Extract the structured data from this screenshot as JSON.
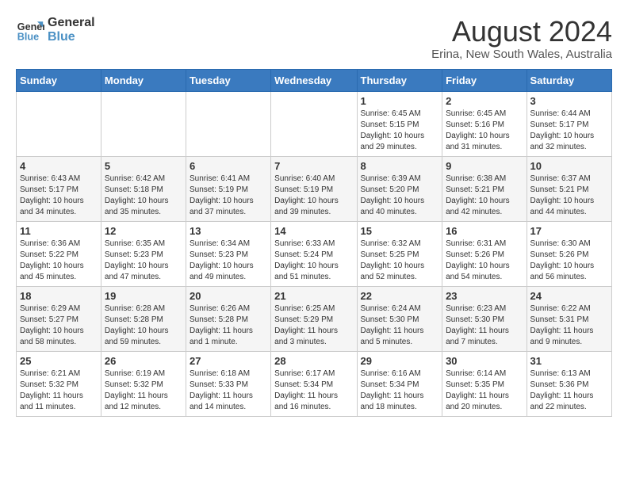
{
  "logo": {
    "line1": "General",
    "line2": "Blue"
  },
  "title": "August 2024",
  "subtitle": "Erina, New South Wales, Australia",
  "days_of_week": [
    "Sunday",
    "Monday",
    "Tuesday",
    "Wednesday",
    "Thursday",
    "Friday",
    "Saturday"
  ],
  "weeks": [
    [
      {
        "day": "",
        "info": ""
      },
      {
        "day": "",
        "info": ""
      },
      {
        "day": "",
        "info": ""
      },
      {
        "day": "",
        "info": ""
      },
      {
        "day": "1",
        "info": "Sunrise: 6:45 AM\nSunset: 5:15 PM\nDaylight: 10 hours\nand 29 minutes."
      },
      {
        "day": "2",
        "info": "Sunrise: 6:45 AM\nSunset: 5:16 PM\nDaylight: 10 hours\nand 31 minutes."
      },
      {
        "day": "3",
        "info": "Sunrise: 6:44 AM\nSunset: 5:17 PM\nDaylight: 10 hours\nand 32 minutes."
      }
    ],
    [
      {
        "day": "4",
        "info": "Sunrise: 6:43 AM\nSunset: 5:17 PM\nDaylight: 10 hours\nand 34 minutes."
      },
      {
        "day": "5",
        "info": "Sunrise: 6:42 AM\nSunset: 5:18 PM\nDaylight: 10 hours\nand 35 minutes."
      },
      {
        "day": "6",
        "info": "Sunrise: 6:41 AM\nSunset: 5:19 PM\nDaylight: 10 hours\nand 37 minutes."
      },
      {
        "day": "7",
        "info": "Sunrise: 6:40 AM\nSunset: 5:19 PM\nDaylight: 10 hours\nand 39 minutes."
      },
      {
        "day": "8",
        "info": "Sunrise: 6:39 AM\nSunset: 5:20 PM\nDaylight: 10 hours\nand 40 minutes."
      },
      {
        "day": "9",
        "info": "Sunrise: 6:38 AM\nSunset: 5:21 PM\nDaylight: 10 hours\nand 42 minutes."
      },
      {
        "day": "10",
        "info": "Sunrise: 6:37 AM\nSunset: 5:21 PM\nDaylight: 10 hours\nand 44 minutes."
      }
    ],
    [
      {
        "day": "11",
        "info": "Sunrise: 6:36 AM\nSunset: 5:22 PM\nDaylight: 10 hours\nand 45 minutes."
      },
      {
        "day": "12",
        "info": "Sunrise: 6:35 AM\nSunset: 5:23 PM\nDaylight: 10 hours\nand 47 minutes."
      },
      {
        "day": "13",
        "info": "Sunrise: 6:34 AM\nSunset: 5:23 PM\nDaylight: 10 hours\nand 49 minutes."
      },
      {
        "day": "14",
        "info": "Sunrise: 6:33 AM\nSunset: 5:24 PM\nDaylight: 10 hours\nand 51 minutes."
      },
      {
        "day": "15",
        "info": "Sunrise: 6:32 AM\nSunset: 5:25 PM\nDaylight: 10 hours\nand 52 minutes."
      },
      {
        "day": "16",
        "info": "Sunrise: 6:31 AM\nSunset: 5:26 PM\nDaylight: 10 hours\nand 54 minutes."
      },
      {
        "day": "17",
        "info": "Sunrise: 6:30 AM\nSunset: 5:26 PM\nDaylight: 10 hours\nand 56 minutes."
      }
    ],
    [
      {
        "day": "18",
        "info": "Sunrise: 6:29 AM\nSunset: 5:27 PM\nDaylight: 10 hours\nand 58 minutes."
      },
      {
        "day": "19",
        "info": "Sunrise: 6:28 AM\nSunset: 5:28 PM\nDaylight: 10 hours\nand 59 minutes."
      },
      {
        "day": "20",
        "info": "Sunrise: 6:26 AM\nSunset: 5:28 PM\nDaylight: 11 hours\nand 1 minute."
      },
      {
        "day": "21",
        "info": "Sunrise: 6:25 AM\nSunset: 5:29 PM\nDaylight: 11 hours\nand 3 minutes."
      },
      {
        "day": "22",
        "info": "Sunrise: 6:24 AM\nSunset: 5:30 PM\nDaylight: 11 hours\nand 5 minutes."
      },
      {
        "day": "23",
        "info": "Sunrise: 6:23 AM\nSunset: 5:30 PM\nDaylight: 11 hours\nand 7 minutes."
      },
      {
        "day": "24",
        "info": "Sunrise: 6:22 AM\nSunset: 5:31 PM\nDaylight: 11 hours\nand 9 minutes."
      }
    ],
    [
      {
        "day": "25",
        "info": "Sunrise: 6:21 AM\nSunset: 5:32 PM\nDaylight: 11 hours\nand 11 minutes."
      },
      {
        "day": "26",
        "info": "Sunrise: 6:19 AM\nSunset: 5:32 PM\nDaylight: 11 hours\nand 12 minutes."
      },
      {
        "day": "27",
        "info": "Sunrise: 6:18 AM\nSunset: 5:33 PM\nDaylight: 11 hours\nand 14 minutes."
      },
      {
        "day": "28",
        "info": "Sunrise: 6:17 AM\nSunset: 5:34 PM\nDaylight: 11 hours\nand 16 minutes."
      },
      {
        "day": "29",
        "info": "Sunrise: 6:16 AM\nSunset: 5:34 PM\nDaylight: 11 hours\nand 18 minutes."
      },
      {
        "day": "30",
        "info": "Sunrise: 6:14 AM\nSunset: 5:35 PM\nDaylight: 11 hours\nand 20 minutes."
      },
      {
        "day": "31",
        "info": "Sunrise: 6:13 AM\nSunset: 5:36 PM\nDaylight: 11 hours\nand 22 minutes."
      }
    ]
  ]
}
